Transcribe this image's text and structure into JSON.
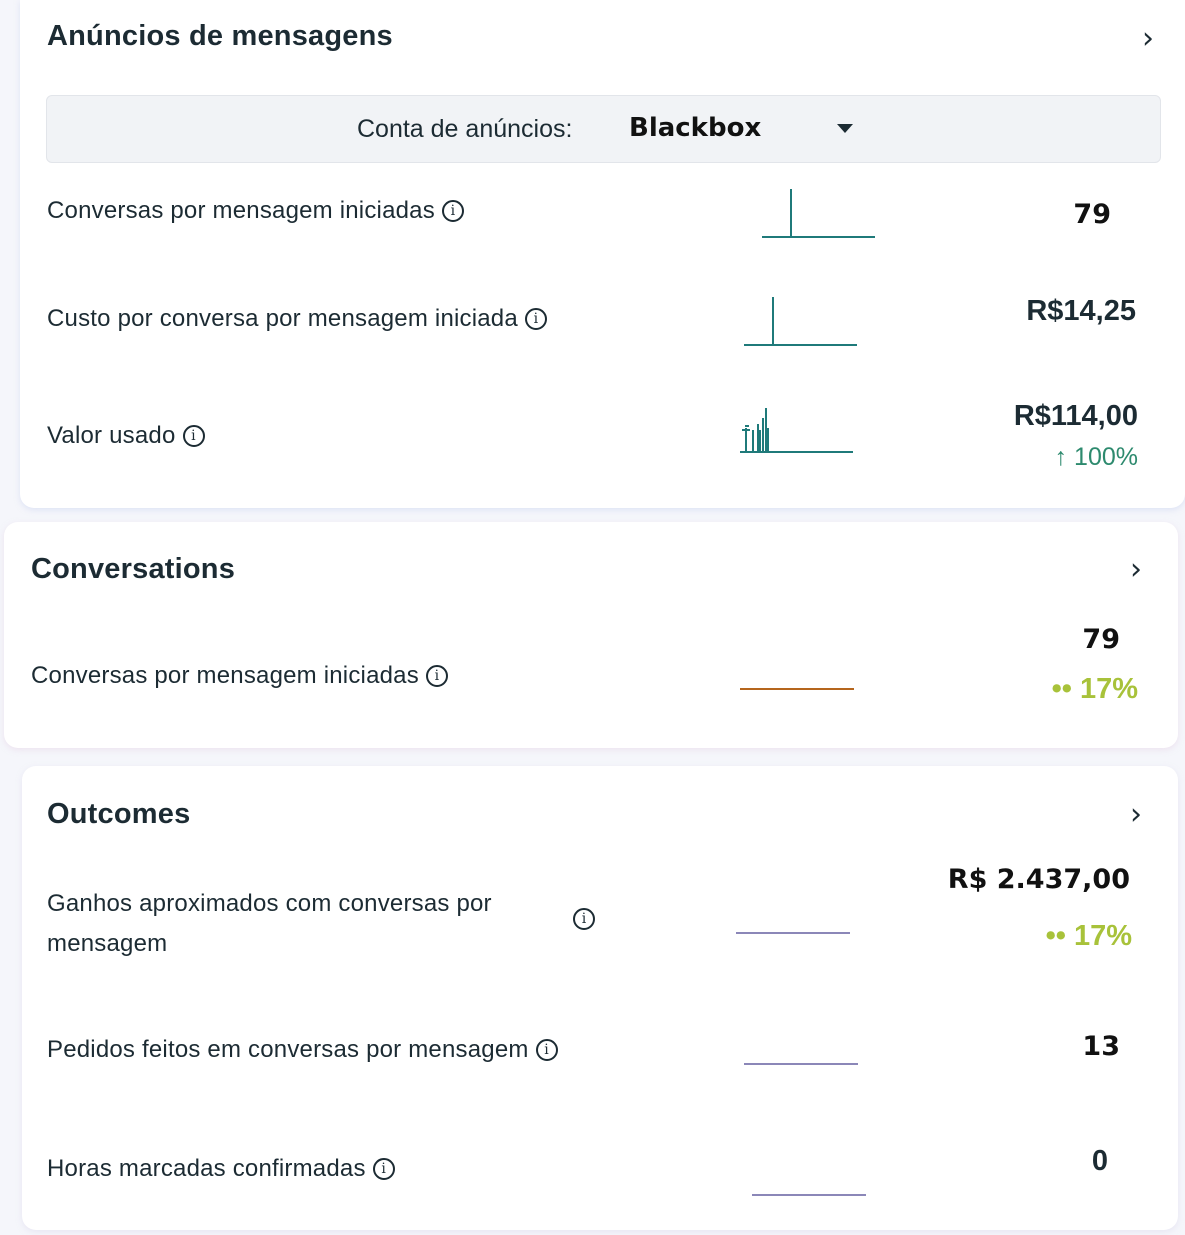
{
  "ads": {
    "title": "Anúncios de mensagens",
    "account_label": "Conta de anúncios:",
    "account_value": "Blackbox",
    "rows": [
      {
        "label": "Conversas por mensagem iniciadas",
        "value": "79"
      },
      {
        "label": "Custo por conversa por mensagem iniciada",
        "value": "R$14,25"
      },
      {
        "label": "Valor usado",
        "value": "R$114,00",
        "delta": "↑ 100%"
      }
    ]
  },
  "conversations": {
    "title": "Conversations",
    "rows": [
      {
        "label": "Conversas por mensagem iniciadas",
        "value": "79",
        "delta": "•• 17%"
      }
    ]
  },
  "outcomes": {
    "title": "Outcomes",
    "rows": [
      {
        "label_line1": "Ganhos aproximados com conversas por",
        "label_line2": "mensagem",
        "value": "R$ 2.437,00",
        "delta": "•• 17%"
      },
      {
        "label": "Pedidos feitos em conversas por mensagem",
        "value": "13"
      },
      {
        "label": "Horas marcadas confirmadas",
        "value": "0"
      }
    ]
  },
  "icons": {
    "chevron": "chevron-right-icon",
    "info": "info-icon",
    "dropdown": "caret-down-icon"
  },
  "colors": {
    "text": "#1c2b33",
    "sparkline_teal": "#1f7a7a",
    "sparkline_orange": "#b5651d",
    "sparkline_purple": "#8b87b8",
    "delta_green": "#2d8a6e",
    "delta_yellowgreen": "#a8c23a"
  }
}
